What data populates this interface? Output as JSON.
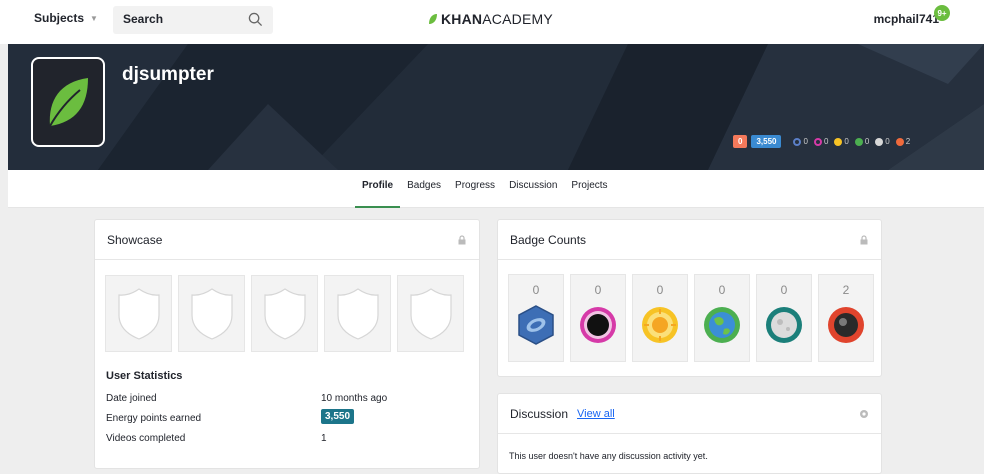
{
  "nav": {
    "subjects_label": "Subjects",
    "search_placeholder": "Search",
    "logo_bold": "KHAN",
    "logo_light": "ACADEMY",
    "username": "mcphail741",
    "notification_count": "9+"
  },
  "profile": {
    "name": "djsumpter",
    "streak": "0",
    "energy_points": "3,550",
    "mini_badges": [
      {
        "icon": "meteorite-badge-icon",
        "count": "0",
        "color": "#5b7fc7"
      },
      {
        "icon": "moon-badge-icon",
        "count": "0",
        "color": "#d63aa8"
      },
      {
        "icon": "earth-badge-icon",
        "count": "0",
        "color": "#f7c325"
      },
      {
        "icon": "sun-badge-icon",
        "count": "0",
        "color": "#4caf50"
      },
      {
        "icon": "black-hole-badge-icon",
        "count": "0",
        "color": "#d8d8d8"
      },
      {
        "icon": "challenge-patch-icon",
        "count": "2",
        "color": "#ef6a3c"
      }
    ]
  },
  "tabs": [
    {
      "label": "Profile",
      "active": true
    },
    {
      "label": "Badges",
      "active": false
    },
    {
      "label": "Progress",
      "active": false
    },
    {
      "label": "Discussion",
      "active": false
    },
    {
      "label": "Projects",
      "active": false
    }
  ],
  "showcase": {
    "title": "Showcase",
    "stats_title": "User Statistics",
    "stats": [
      {
        "label": "Date joined",
        "value": "10 months ago"
      },
      {
        "label": "Energy points earned",
        "value": "3,550"
      },
      {
        "label": "Videos completed",
        "value": "1"
      }
    ]
  },
  "badge_counts": {
    "title": "Badge Counts",
    "items": [
      {
        "name": "meteorite",
        "count": "0"
      },
      {
        "name": "moon",
        "count": "0"
      },
      {
        "name": "earth",
        "count": "0"
      },
      {
        "name": "sun",
        "count": "0"
      },
      {
        "name": "black-hole",
        "count": "0"
      },
      {
        "name": "challenge-patch",
        "count": "2"
      }
    ]
  },
  "discussion": {
    "title": "Discussion",
    "view_all": "View all",
    "empty_text": "This user doesn't have any discussion activity yet."
  },
  "colors": {
    "accent_green": "#3a8f50",
    "energy_blue": "#1c758a",
    "link_blue": "#1865f2",
    "hero_bg": "#1f2a38"
  }
}
